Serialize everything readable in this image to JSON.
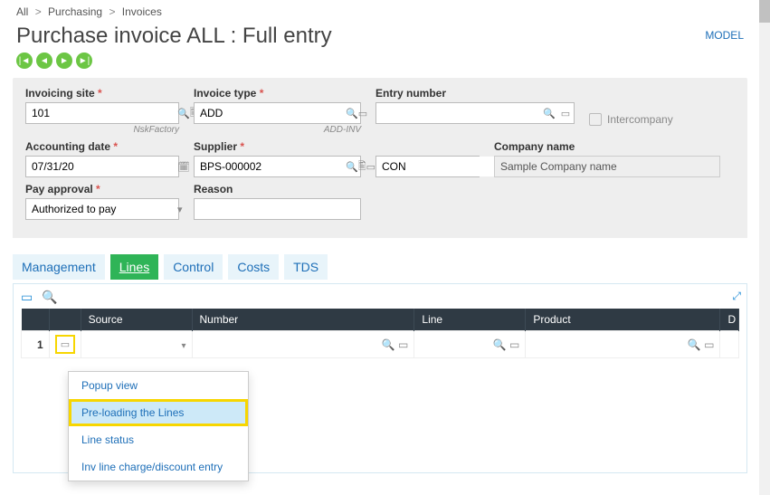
{
  "breadcrumb": {
    "items": [
      "All",
      "Purchasing",
      "Invoices"
    ]
  },
  "header": {
    "title": "Purchase invoice ALL : Full entry",
    "model": "MODEL"
  },
  "form": {
    "invoicing_site": {
      "label": "Invoicing site",
      "value": "101",
      "sub": "NskFactory"
    },
    "invoice_type": {
      "label": "Invoice type",
      "value": "ADD",
      "sub": "ADD-INV"
    },
    "entry_number": {
      "label": "Entry number",
      "value": ""
    },
    "intercompany": {
      "label": "Intercompany"
    },
    "accounting_date": {
      "label": "Accounting date",
      "value": "07/31/20"
    },
    "supplier": {
      "label": "Supplier",
      "value": "BPS-000002"
    },
    "supplier_short": {
      "value": "CON"
    },
    "company_name": {
      "label": "Company name",
      "value": "Sample Company name"
    },
    "pay_approval": {
      "label": "Pay approval",
      "value": "Authorized to pay"
    },
    "reason": {
      "label": "Reason",
      "value": ""
    }
  },
  "tabs": [
    "Management",
    "Lines",
    "Control",
    "Costs",
    "TDS"
  ],
  "grid": {
    "cols": [
      "",
      "",
      "Source",
      "Number",
      "Line",
      "Product",
      "D"
    ],
    "row1_num": "1"
  },
  "menu": {
    "items": [
      "Popup view",
      "Pre-loading the Lines",
      "Line status",
      "Inv line charge/discount entry"
    ]
  }
}
